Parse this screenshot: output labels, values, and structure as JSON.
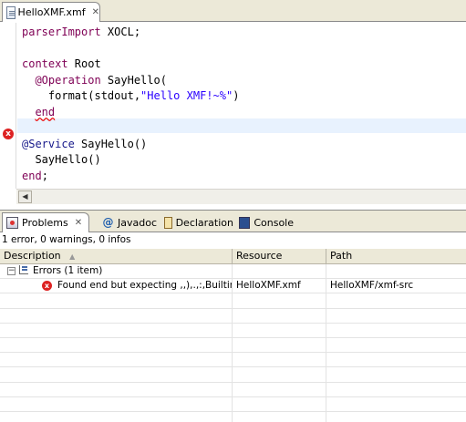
{
  "editor": {
    "tab": {
      "label": "HelloXMF.xmf",
      "close": "✕"
    },
    "lines": [
      [
        {
          "t": "parserImport",
          "c": "kw"
        },
        {
          "t": " XOCL;",
          "c": ""
        }
      ],
      [],
      [
        {
          "t": "context",
          "c": "kw"
        },
        {
          "t": " Root",
          "c": ""
        }
      ],
      [
        {
          "t": "  ",
          "c": ""
        },
        {
          "t": "@Operation",
          "c": "purple"
        },
        {
          "t": " SayHello(",
          "c": ""
        }
      ],
      [
        {
          "t": "    format(stdout,",
          "c": ""
        },
        {
          "t": "\"Hello XMF!~%\"",
          "c": "str"
        },
        {
          "t": ")",
          "c": ""
        }
      ],
      [
        {
          "t": "  ",
          "c": ""
        },
        {
          "t": "end",
          "c": "kw err"
        }
      ],
      [],
      [
        {
          "t": "@Service",
          "c": "navy"
        },
        {
          "t": " SayHello()",
          "c": ""
        }
      ],
      [
        {
          "t": "  SayHello()",
          "c": ""
        }
      ],
      [
        {
          "t": "end",
          "c": "kw"
        },
        {
          "t": ";",
          "c": ""
        }
      ]
    ],
    "error_marker": "x",
    "scroll_left": "◀"
  },
  "panel": {
    "tabs": [
      {
        "label": "Problems",
        "icon": "problems-icon",
        "close": "✕"
      },
      {
        "label": "Javadoc",
        "icon": "javadoc-icon",
        "glyph": "@"
      },
      {
        "label": "Declaration",
        "icon": "declaration-icon"
      },
      {
        "label": "Console",
        "icon": "console-icon"
      }
    ],
    "summary": "1 error, 0 warnings, 0 infos",
    "columns": [
      "Description",
      "Resource",
      "Path"
    ],
    "sort_arrow": "▲",
    "group": {
      "expander": "−",
      "label": "Errors (1 item)"
    },
    "error": {
      "description": "Found end but expecting ,,),.,:,Builtin(E",
      "resource": "HelloXMF.xmf",
      "path": "HelloXMF/xmf-src"
    }
  }
}
